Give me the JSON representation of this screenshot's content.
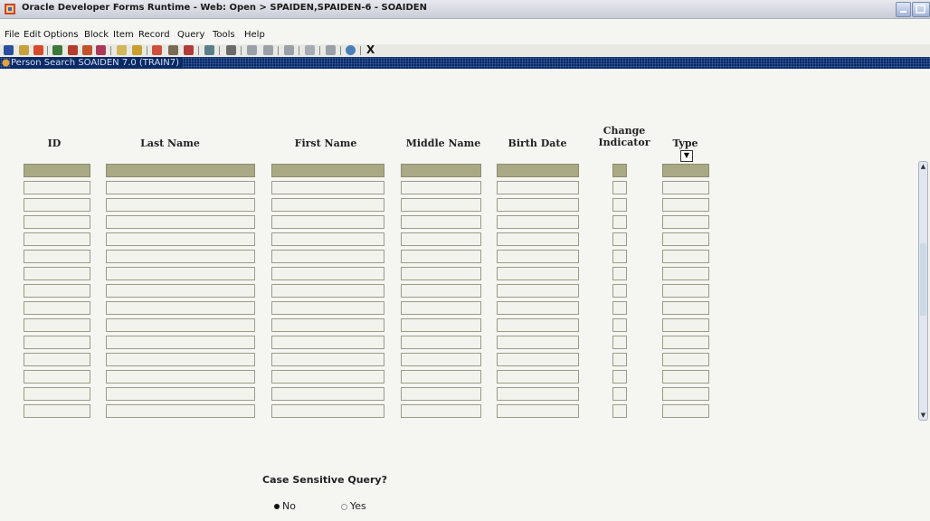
{
  "window": {
    "title": "Oracle Developer Forms Runtime - Web:  Open > SPAIDEN,SPAIDEN-6 - SOAIDEN"
  },
  "menu": [
    "File",
    "Edit",
    "Options",
    "Block",
    "Item",
    "Record",
    "Query",
    "Tools",
    "Help"
  ],
  "toolbar": {
    "exit_label": "X"
  },
  "form": {
    "title": "Person Search  SOAIDEN  7.0  (TRAIN7)"
  },
  "columns": {
    "id": "ID",
    "last_name": "Last Name",
    "first_name": "First Name",
    "middle_name": "Middle Name",
    "birth_date": "Birth Date",
    "change_indicator_line1": "Change",
    "change_indicator_line2": "Indicator",
    "type": "Type"
  },
  "grid": {
    "rows": 15
  },
  "case_sensitive": {
    "label": "Case Sensitive Query?",
    "options": [
      "No",
      "Yes"
    ],
    "selected": "No"
  },
  "colors": {
    "form_bar": "#0a2a66",
    "highlight_row": "#a9a985"
  }
}
